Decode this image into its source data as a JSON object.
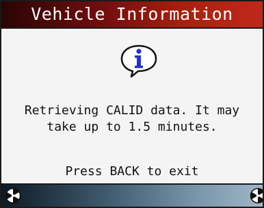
{
  "header": {
    "title": "Vehicle Information"
  },
  "status": {
    "icon": "info-icon",
    "message": "Retrieving CALID data. It may\ntake up to 1.5 minutes.",
    "hint": "Press BACK to exit"
  },
  "footer": {
    "left_button_icon": "soft-key-icon",
    "right_button_icon": "soft-key-icon"
  },
  "colors": {
    "title_bar": "#a9200f",
    "info_icon": "#1f2fd6",
    "bottom_bar": "#3f5a6e"
  }
}
